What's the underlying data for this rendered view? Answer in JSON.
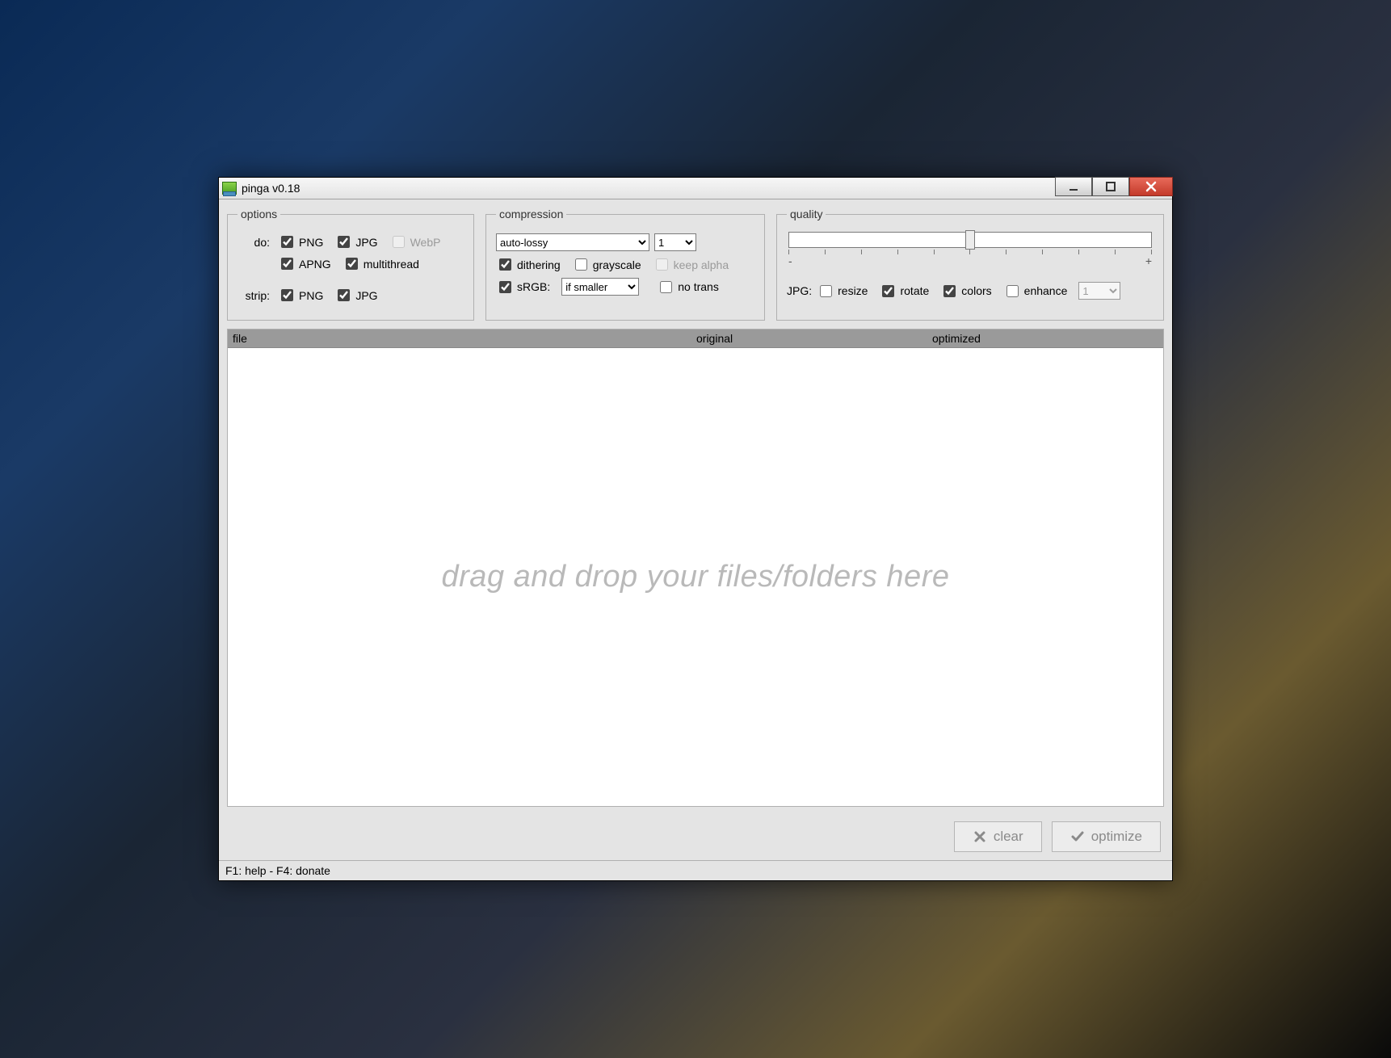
{
  "window": {
    "title": "pinga v0.18"
  },
  "options": {
    "legend": "options",
    "do_label": "do:",
    "png": {
      "label": "PNG",
      "checked": true
    },
    "jpg": {
      "label": "JPG",
      "checked": true
    },
    "webp": {
      "label": "WebP",
      "checked": false,
      "disabled": true
    },
    "apng": {
      "label": "APNG",
      "checked": true
    },
    "multithread": {
      "label": "multithread",
      "checked": true
    },
    "strip_label": "strip:",
    "strip_png": {
      "label": "PNG",
      "checked": true
    },
    "strip_jpg": {
      "label": "JPG",
      "checked": true
    }
  },
  "compression": {
    "legend": "compression",
    "mode": "auto-lossy",
    "level": "1",
    "dithering": {
      "label": "dithering",
      "checked": true
    },
    "grayscale": {
      "label": "grayscale",
      "checked": false
    },
    "keep_alpha": {
      "label": "keep alpha",
      "checked": false,
      "disabled": true
    },
    "srgb": {
      "label": "sRGB:",
      "checked": true
    },
    "srgb_mode": "if smaller",
    "no_trans": {
      "label": "no trans",
      "checked": false
    }
  },
  "quality": {
    "legend": "quality",
    "minus": "-",
    "plus": "+",
    "jpg_label": "JPG:",
    "resize": {
      "label": "resize",
      "checked": false
    },
    "rotate": {
      "label": "rotate",
      "checked": true
    },
    "colors": {
      "label": "colors",
      "checked": true
    },
    "enhance": {
      "label": "enhance",
      "checked": false
    },
    "enhance_level": "1"
  },
  "filelist": {
    "col_file": "file",
    "col_original": "original",
    "col_optimized": "optimized",
    "drop_hint": "drag and drop your files/folders here"
  },
  "buttons": {
    "clear": "clear",
    "optimize": "optimize"
  },
  "status": "F1: help - F4: donate"
}
